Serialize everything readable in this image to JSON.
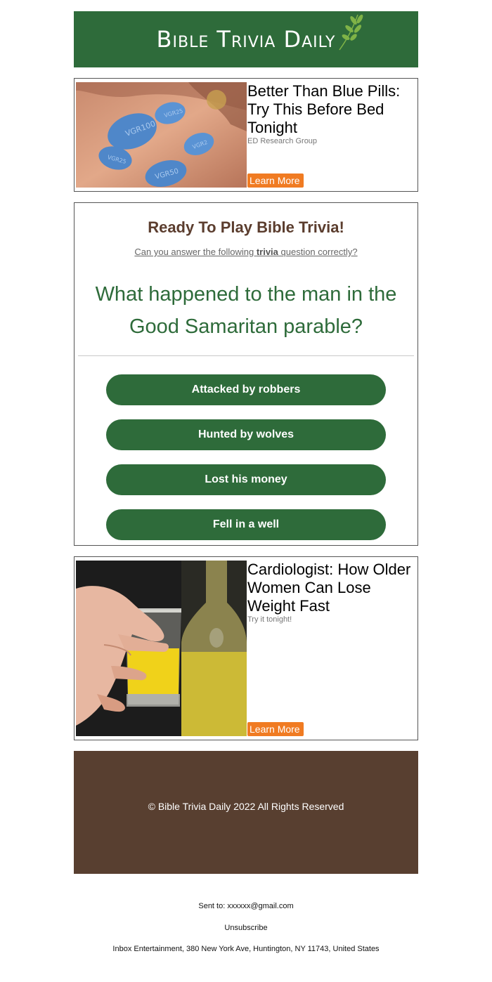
{
  "header": {
    "logo_text": "Bible Trivia Daily",
    "logo_icon": "olive-branch-icon",
    "background_color": "#2e6b3a"
  },
  "ad_top": {
    "image": "blue-pills-in-hand-image",
    "title": "Better Than Blue Pills: Try This Before Bed Tonight",
    "sponsor": "ED Research Group",
    "button_label": "Learn More"
  },
  "trivia": {
    "heading": "Ready To Play Bible Trivia!",
    "subheading_before": "Can you answer the following ",
    "subheading_bold": "trivia",
    "subheading_after": " question correctly?",
    "question": "What happened to the man in the Good Samaritan parable?",
    "answers": [
      "Attacked by robbers",
      "Hunted by wolves",
      "Lost his money",
      "Fell in a well"
    ],
    "accent_color": "#2e6b3a",
    "heading_color": "#5b3d2e"
  },
  "ad_bottom": {
    "image": "yellow-drink-shot-glass-image",
    "title": "Cardiologist: How Older Women Can Lose Weight Fast",
    "sponsor": "Try it tonight!",
    "button_label": "Learn More"
  },
  "footer": {
    "copyright": "© Bible Trivia Daily 2022 All Rights Reserved",
    "background_color": "#583f30"
  },
  "meta": {
    "sent_to": "Sent to: xxxxxx@gmail.com",
    "unsubscribe": "Unsubscribe",
    "address": "Inbox Entertainment, 380 New York Ave, Huntington, NY 11743, United States"
  },
  "cta_color": "#f07b22"
}
